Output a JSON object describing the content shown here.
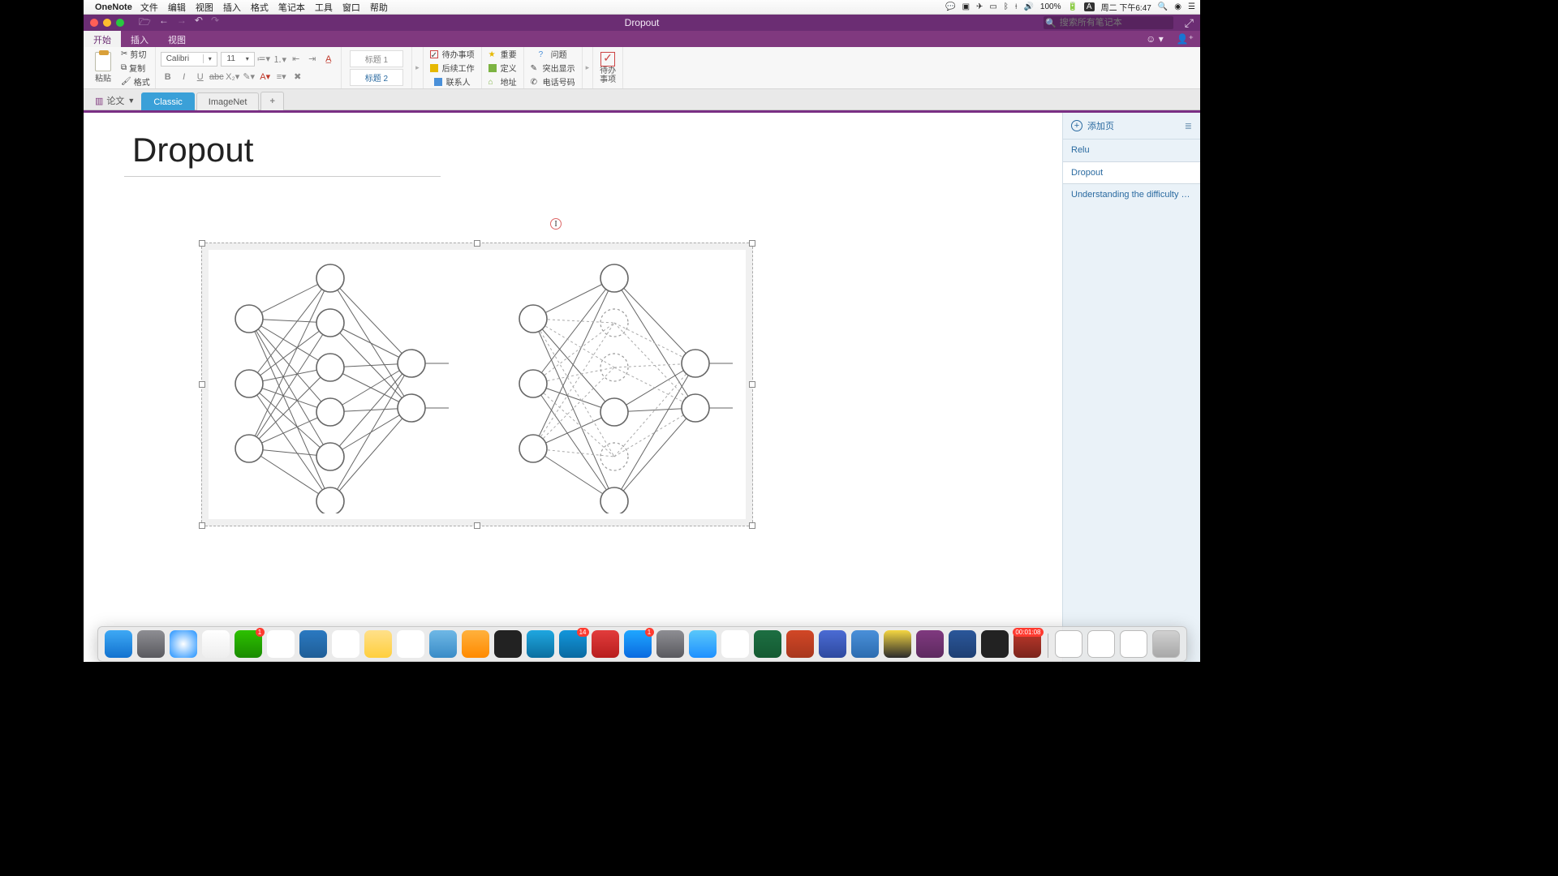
{
  "menubar": {
    "app": "OneNote",
    "items": [
      "文件",
      "编辑",
      "视图",
      "插入",
      "格式",
      "笔记本",
      "工具",
      "窗口",
      "帮助"
    ],
    "battery": "100%",
    "clock": "周二 下午6:47"
  },
  "titlebar": {
    "title": "Dropout",
    "search_placeholder": "搜索所有笔记本"
  },
  "ribbonTabs": {
    "start": "开始",
    "insert": "插入",
    "view": "视图"
  },
  "ribbon": {
    "paste": "粘贴",
    "cut": "剪切",
    "copy": "复制",
    "format": "格式",
    "font_name": "Calibri",
    "font_size": "11",
    "heading1": "标题 1",
    "heading2": "标题 2",
    "tags": {
      "todo": "待办事项",
      "followup": "后续工作",
      "contact": "联系人",
      "important": "重要",
      "definition": "定义",
      "address": "地址",
      "question": "问题",
      "highlight": "突出显示",
      "phone": "电话号码"
    },
    "todo_label": "待办\n事项"
  },
  "notebook": {
    "name": "论文"
  },
  "sections": {
    "classic": "Classic",
    "imagenet": "ImageNet"
  },
  "page": {
    "title": "Dropout"
  },
  "pagePanel": {
    "add": "添加页",
    "pages": [
      "Relu",
      "Dropout",
      "Understanding the difficulty of tr…"
    ],
    "activeIndex": 1
  },
  "dock": {
    "apps": [
      {
        "name": "finder",
        "bg": "linear-gradient(#3ea9f5,#1272cf)"
      },
      {
        "name": "launchpad",
        "bg": "linear-gradient(#8e8e93,#5a5a5f)"
      },
      {
        "name": "safari",
        "bg": "radial-gradient(#fff,#1e90ff)"
      },
      {
        "name": "qq",
        "bg": "linear-gradient(#fff,#eee)"
      },
      {
        "name": "wechat",
        "bg": "linear-gradient(#2dc100,#1a8b00)",
        "badge": "1"
      },
      {
        "name": "calendar",
        "bg": "#fff"
      },
      {
        "name": "vscode",
        "bg": "linear-gradient(#2b79c1,#1f5e97)"
      },
      {
        "name": "reminders",
        "bg": "#fff"
      },
      {
        "name": "notes",
        "bg": "linear-gradient(#ffe08a,#ffcf3d)"
      },
      {
        "name": "photos",
        "bg": "#fff"
      },
      {
        "name": "ibooks",
        "bg": "linear-gradient(#6fb8e6,#3a8cc7)"
      },
      {
        "name": "calculator",
        "bg": "linear-gradient(#ffb13d,#ff8a00)"
      },
      {
        "name": "terminal",
        "bg": "#222"
      },
      {
        "name": "keynote",
        "bg": "linear-gradient(#1fa7e0,#0b6fa0)"
      },
      {
        "name": "kugou",
        "bg": "linear-gradient(#1296db,#0a6aa1)",
        "badge": "14"
      },
      {
        "name": "netease",
        "bg": "linear-gradient(#e23c3c,#b81e1e)"
      },
      {
        "name": "appstore",
        "bg": "linear-gradient(#1fa7ff,#0a6ae0)",
        "badge": "1"
      },
      {
        "name": "settings",
        "bg": "linear-gradient(#8e8e93,#5a5a5f)"
      },
      {
        "name": "preview",
        "bg": "linear-gradient(#5ac8fa,#1e90ff)"
      },
      {
        "name": "textedit",
        "bg": "#fff"
      },
      {
        "name": "excel",
        "bg": "linear-gradient(#1d6f42,#145a32)"
      },
      {
        "name": "powerpoint",
        "bg": "linear-gradient(#d24726,#a8371e)"
      },
      {
        "name": "wps",
        "bg": "linear-gradient(#4b6cd4,#2e4aa0)"
      },
      {
        "name": "vm",
        "bg": "linear-gradient(#4a90d9,#2c6cb0)"
      },
      {
        "name": "pycharm",
        "bg": "linear-gradient(#f5d742,#2b2b2b)"
      },
      {
        "name": "onenote",
        "bg": "linear-gradient(#80397f,#5e2a60)"
      },
      {
        "name": "word",
        "bg": "linear-gradient(#2b579a,#1e3f73)"
      },
      {
        "name": "activity",
        "bg": "#222"
      },
      {
        "name": "record",
        "bg": "linear-gradient(#c0392b,#7b241c)",
        "badge": "00:01:08"
      }
    ],
    "recent": [
      {
        "name": "doc1",
        "bg": "#fff"
      },
      {
        "name": "doc2",
        "bg": "#fff"
      },
      {
        "name": "doc3",
        "bg": "#fff"
      },
      {
        "name": "trash",
        "bg": "linear-gradient(#d0d0d0,#a8a8a8)"
      }
    ]
  }
}
